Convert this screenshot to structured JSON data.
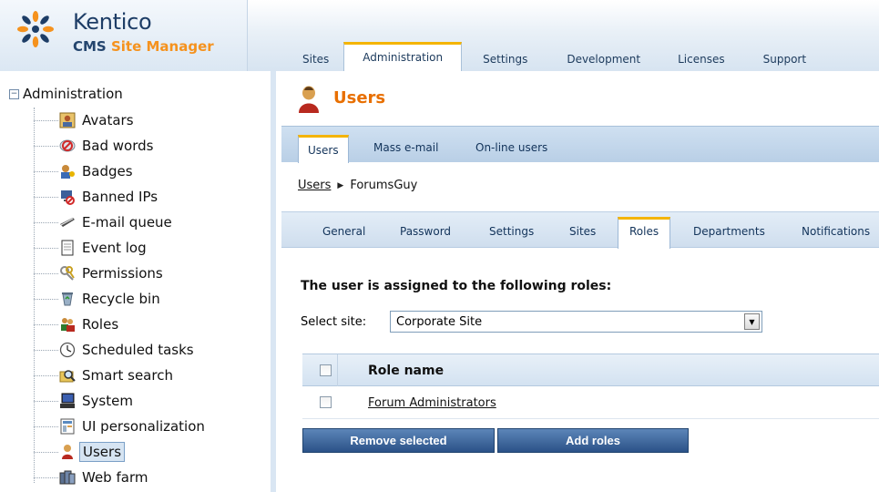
{
  "app": {
    "logo_title": "Kentico",
    "logo_sub_prefix": "CMS ",
    "logo_sub_accent": "Site Manager"
  },
  "topnav": [
    {
      "label": "Sites",
      "active": false
    },
    {
      "label": "Administration",
      "active": true
    },
    {
      "label": "Settings",
      "active": false
    },
    {
      "label": "Development",
      "active": false
    },
    {
      "label": "Licenses",
      "active": false
    },
    {
      "label": "Support",
      "active": false
    }
  ],
  "sidebar": {
    "root_label": "Administration",
    "root_expander": "−",
    "items": [
      {
        "label": "Avatars",
        "icon": "avatar-icon"
      },
      {
        "label": "Bad words",
        "icon": "bad-words-icon"
      },
      {
        "label": "Badges",
        "icon": "badges-icon"
      },
      {
        "label": "Banned IPs",
        "icon": "banned-ip-icon"
      },
      {
        "label": "E-mail queue",
        "icon": "email-queue-icon"
      },
      {
        "label": "Event log",
        "icon": "event-log-icon"
      },
      {
        "label": "Permissions",
        "icon": "permissions-icon"
      },
      {
        "label": "Recycle bin",
        "icon": "recycle-bin-icon"
      },
      {
        "label": "Roles",
        "icon": "roles-icon"
      },
      {
        "label": "Scheduled tasks",
        "icon": "clock-icon"
      },
      {
        "label": "Smart search",
        "icon": "smart-search-icon"
      },
      {
        "label": "System",
        "icon": "system-icon"
      },
      {
        "label": "UI personalization",
        "icon": "ui-personalization-icon"
      },
      {
        "label": "Users",
        "icon": "user-icon",
        "selected": true
      },
      {
        "label": "Web farm",
        "icon": "web-farm-icon"
      }
    ]
  },
  "main": {
    "title": "Users",
    "tabs1": [
      {
        "label": "Users",
        "active": true
      },
      {
        "label": "Mass e-mail",
        "active": false
      },
      {
        "label": "On-line users",
        "active": false
      }
    ],
    "breadcrumb": {
      "link": "Users",
      "current": "ForumsGuy"
    },
    "tabs2": [
      {
        "label": "General",
        "active": false
      },
      {
        "label": "Password",
        "active": false
      },
      {
        "label": "Settings",
        "active": false
      },
      {
        "label": "Sites",
        "active": false
      },
      {
        "label": "Roles",
        "active": true
      },
      {
        "label": "Departments",
        "active": false
      },
      {
        "label": "Notifications",
        "active": false
      }
    ],
    "section_heading": "The user is assigned to the following roles:",
    "select_label": "Select site:",
    "select_value": "Corporate Site",
    "grid": {
      "header": "Role name",
      "rows": [
        {
          "role": "Forum Administrators",
          "checked": false
        }
      ]
    },
    "buttons": {
      "remove": "Remove selected",
      "add": "Add roles"
    }
  },
  "colors": {
    "accent_orange": "#e86f00",
    "tab_highlight": "#f4b400",
    "button_blue": "#2b5288",
    "tab_bar_blue": "#b9cfe6"
  }
}
